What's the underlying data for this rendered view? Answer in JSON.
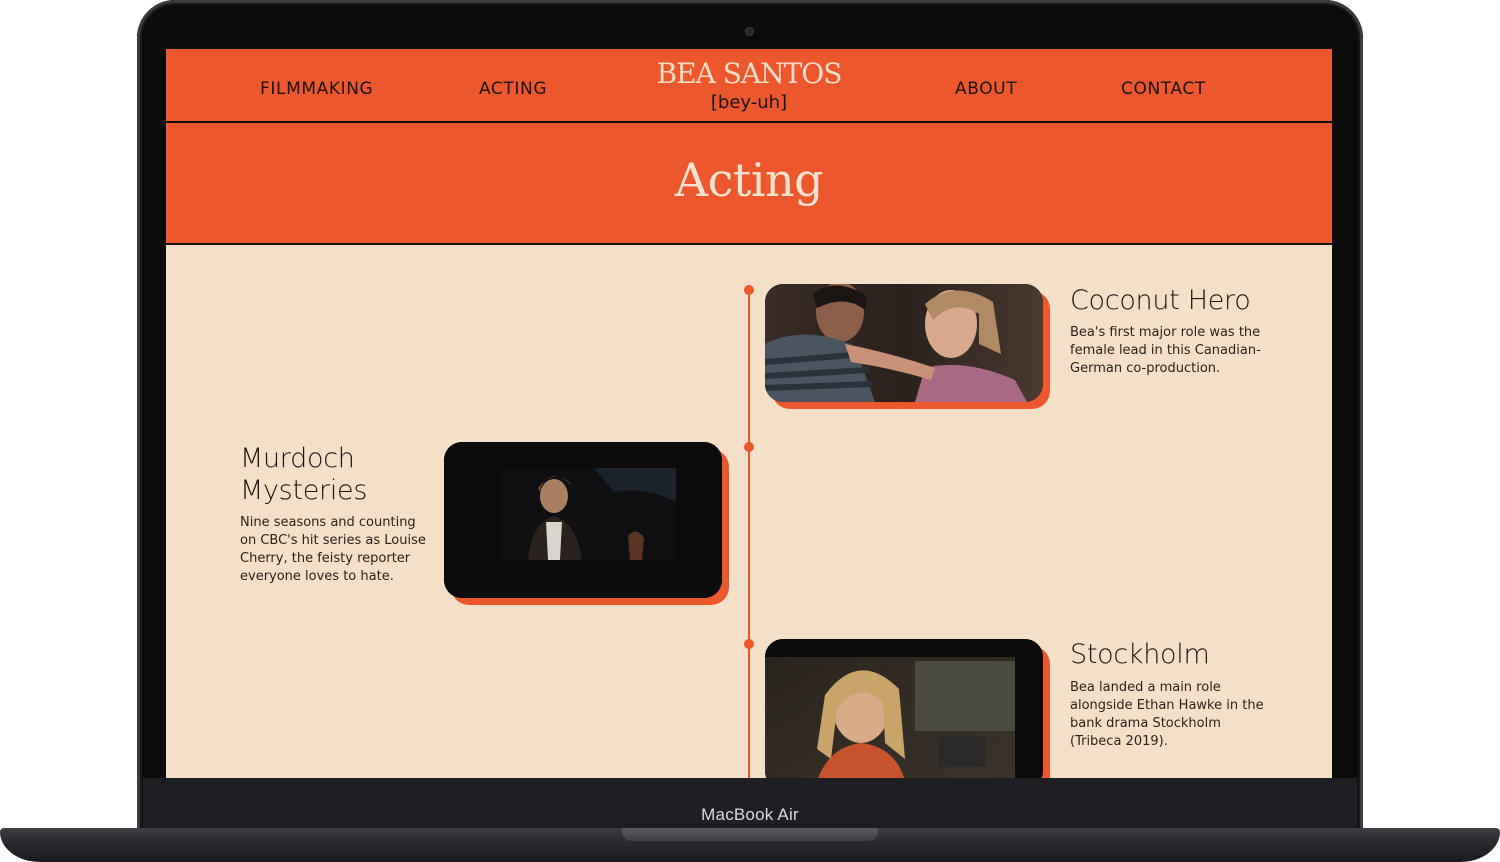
{
  "nav": {
    "left_links": [
      "FILMMAKING",
      "ACTING"
    ],
    "right_links": [
      "ABOUT",
      "CONTACT"
    ],
    "brand_name": "BEA SANTOS",
    "brand_pronunciation": "[bey-uh]"
  },
  "hero": {
    "title": "Acting"
  },
  "entries": [
    {
      "title": "Coconut Hero",
      "text": "Bea's first major role was the female lead in this Canadian-German co-production."
    },
    {
      "title": "Murdoch Mysteries",
      "text": "Nine seasons and counting on CBC's hit series as Louise Cherry, the feisty reporter everyone loves to hate."
    },
    {
      "title": "Stockholm",
      "text": "Bea landed a main role alongside Ethan Hawke in the bank drama Stockholm (Tribeca 2019)."
    }
  ],
  "device": {
    "label": "MacBook Air"
  },
  "colors": {
    "accent": "#ec572e",
    "background": "#f4dfc8",
    "brand_text": "#f6dcc6",
    "dark": "#1b1410"
  }
}
